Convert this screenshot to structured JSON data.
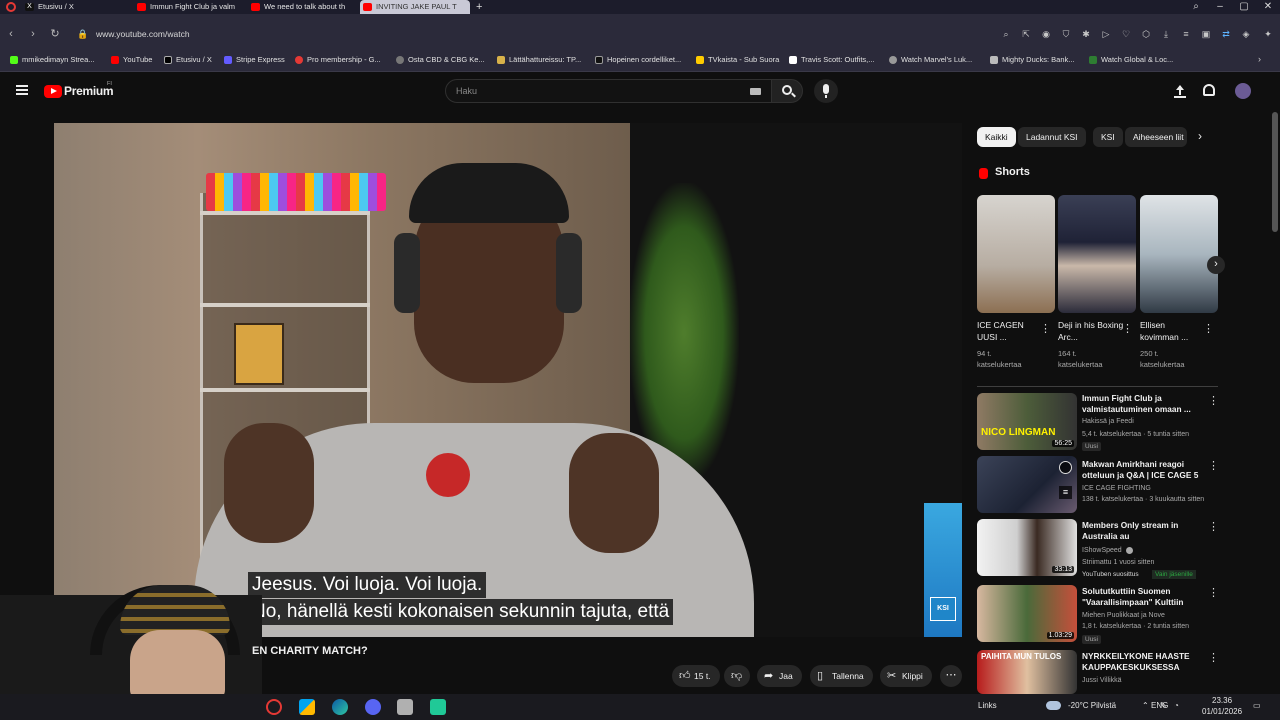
{
  "browser": {
    "tabs": [
      {
        "label": "Etusivu / X",
        "color": "#d32f2f"
      },
      {
        "label": "Immun Fight Club ja valm",
        "color": "#ff0000"
      },
      {
        "label": "We need to talk about th",
        "color": "#ff0000"
      },
      {
        "label": "INVITING JAKE PAUL T",
        "color": "#ff0000"
      }
    ],
    "new_tab": "+",
    "url": "www.youtube.com/watch",
    "bookmarks": [
      "mmikedimayn Strea...",
      "YouTube",
      "Etusivu / X",
      "Stripe Express",
      "Pro membership - G...",
      "Osta CBD & CBG Ke...",
      "Lättähattureissu: TP...",
      "Hopeinen cordelliket...",
      "TVkaista - Sub Suora",
      "Travis Scott: Outfits,...",
      "Watch Marvel's Luk...",
      "Mighty Ducks: Bank...",
      "Watch Global & Loc..."
    ]
  },
  "youtube": {
    "logo": "Premium",
    "region": "FI",
    "search_placeholder": "Haku",
    "video": {
      "caption_line1": "Jeesus.  Voi luoja.  Voi luoja.",
      "caption_line2": "No, hänellä kesti kokonaisen sekunnin tajuta, että",
      "corner_logo": "KSI",
      "title": "EN CHARITY MATCH?"
    },
    "actions": {
      "likes": "15 t.",
      "share": "Jaa",
      "save": "Tallenna",
      "clip": "Klippi"
    },
    "chips": [
      "Kaikki",
      "Ladannut KSI",
      "KSI",
      "Aiheeseen liit"
    ],
    "shorts": {
      "heading": "Shorts",
      "items": [
        {
          "title": "ICE CAGEN UUSI ...",
          "views": "94 t. katselukertaa"
        },
        {
          "title": "Deji in his Boxing Arc...",
          "views": "164 t. katselukertaa"
        },
        {
          "title": "Ellisen kovimman ...",
          "views": "250 t. katselukertaa"
        }
      ]
    },
    "recommendations": [
      {
        "title": "Immun Fight Club ja valmistautuminen omaan ...",
        "channel": "Hakissä ja Feedi",
        "meta": "5,4 t. katselukertaa · 5 tuntia sitten",
        "badge": "Uusi",
        "duration": "56:25",
        "thumb_text": "NICO LINGMAN"
      },
      {
        "title": "Makwan Amirkhani reagoi otteluun ja Q&A | ICE CAGE 5",
        "channel": "ICE CAGE FIGHTING",
        "meta": "138 t. katselukertaa · 3 kuukautta sitten",
        "badge": "",
        "duration": "",
        "thumb_text": ""
      },
      {
        "title": "Members Only stream in Australia au",
        "channel": "IShowSpeed",
        "meta": "Striimattu 1 vuosi sitten",
        "badge": "YouTuben suosittus",
        "members": "Vain jäsenille",
        "duration": "33:13",
        "thumb_text": ""
      },
      {
        "title": "Solututkuttiin Suomen \"Vaarallisimpaan\" Kulttiin",
        "channel": "Miehen Puolikkaat ja Nove",
        "meta": "1,8 t. katselukertaa · 2 tuntia sitten",
        "badge": "Uusi",
        "duration": "1.03:29",
        "thumb_text": ""
      },
      {
        "title": "NYRKKEILYKONE HAASTE KAUPPAKESKUKSESSA",
        "channel": "Jussi Villikkä",
        "meta": "",
        "badge": "",
        "duration": "",
        "thumb_text": "PAIHITA MUN TULOS"
      }
    ]
  },
  "taskbar": {
    "links": "Links",
    "weather": "-20°C  Pilvistä",
    "lang": "ENG",
    "time": "23.36",
    "date": "01/01/2026"
  },
  "colors": {
    "yt_red": "#ff0000",
    "bg": "#0f0f0f",
    "chip_bg": "#272727",
    "members_green": "#2ba640"
  }
}
